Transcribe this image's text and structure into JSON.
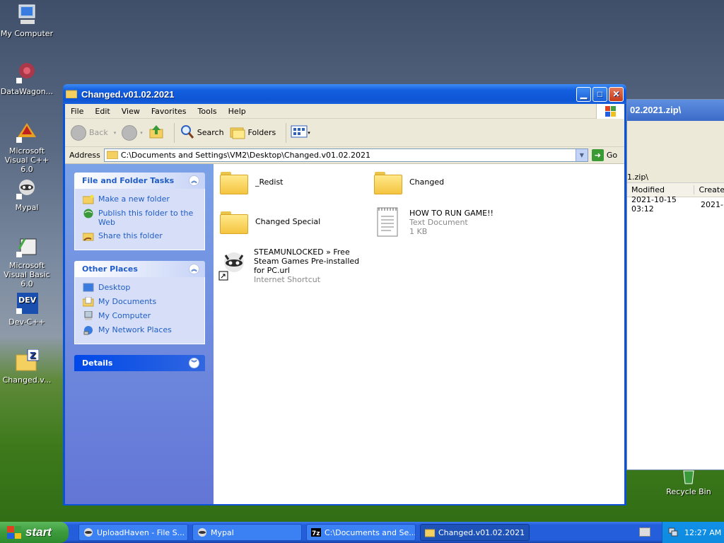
{
  "desktop": {
    "icons": [
      {
        "label": "My Computer"
      },
      {
        "label": "DataWagon..."
      },
      {
        "label": "Microsoft Visual C++ 6.0"
      },
      {
        "label": "Mypal"
      },
      {
        "label": "Microsoft Visual Basic 6.0"
      },
      {
        "label": "Dev-C++"
      },
      {
        "label": "Changed.v..."
      },
      {
        "label": "Recycle Bin"
      }
    ]
  },
  "background_window": {
    "title": "02.2021.zip\\",
    "path_fragment": "1.zip\\",
    "columns": [
      "Modified",
      "Create"
    ],
    "row": [
      "2021-10-15 03:12",
      "2021-"
    ]
  },
  "window": {
    "title": "Changed.v01.02.2021",
    "menu": [
      "File",
      "Edit",
      "View",
      "Favorites",
      "Tools",
      "Help"
    ],
    "toolbar": {
      "back": "Back",
      "search": "Search",
      "folders": "Folders"
    },
    "address": {
      "label": "Address",
      "value": "C:\\Documents and Settings\\VM2\\Desktop\\Changed.v01.02.2021",
      "go": "Go"
    },
    "tasks": {
      "title": "File and Folder Tasks",
      "items": [
        "Make a new folder",
        "Publish this folder to the Web",
        "Share this folder"
      ]
    },
    "other_places": {
      "title": "Other Places",
      "items": [
        "Desktop",
        "My Documents",
        "My Computer",
        "My Network Places"
      ]
    },
    "details": {
      "title": "Details"
    },
    "files": [
      {
        "name": "_Redist",
        "type": "folder"
      },
      {
        "name": "Changed",
        "type": "folder"
      },
      {
        "name": "Changed Special",
        "type": "folder"
      },
      {
        "name": "HOW TO RUN GAME!!",
        "sub1": "Text Document",
        "sub2": "1 KB"
      },
      {
        "name": "STEAMUNLOCKED » Free Steam Games Pre-installed for PC.url",
        "sub1": "Internet Shortcut"
      }
    ]
  },
  "taskbar": {
    "start": "start",
    "buttons": [
      {
        "label": "UploadHaven - File S..."
      },
      {
        "label": "Mypal"
      },
      {
        "label": "C:\\Documents and Se..."
      },
      {
        "label": "Changed.v01.02.2021"
      }
    ],
    "clock": "12:27 AM"
  }
}
